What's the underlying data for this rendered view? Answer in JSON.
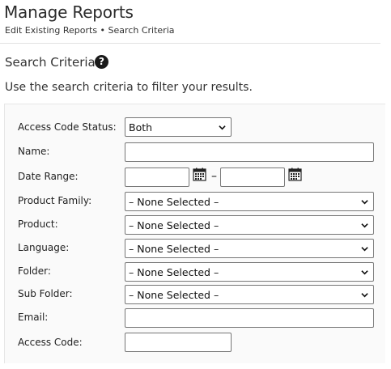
{
  "header": {
    "title": "Manage Reports",
    "breadcrumb": "Edit Existing Reports • Search Criteria"
  },
  "section": {
    "title": "Search Criteria",
    "help_icon": "question-circle-icon",
    "description": "Use the search criteria to filter your results."
  },
  "form": {
    "access_code_status": {
      "label": "Access Code Status:",
      "value": "Both"
    },
    "name": {
      "label": "Name:",
      "value": ""
    },
    "date_range": {
      "label": "Date Range:",
      "from": "",
      "to": "",
      "separator": "–",
      "calendar_icon": "calendar-icon"
    },
    "product_family": {
      "label": "Product Family:",
      "value": "– None Selected –"
    },
    "product": {
      "label": "Product:",
      "value": "– None Selected –"
    },
    "language": {
      "label": "Language:",
      "value": "– None Selected –"
    },
    "folder": {
      "label": "Folder:",
      "value": "– None Selected –"
    },
    "sub_folder": {
      "label": "Sub Folder:",
      "value": "– None Selected –"
    },
    "email": {
      "label": "Email:",
      "value": ""
    },
    "access_code": {
      "label": "Access Code:",
      "value": ""
    }
  }
}
